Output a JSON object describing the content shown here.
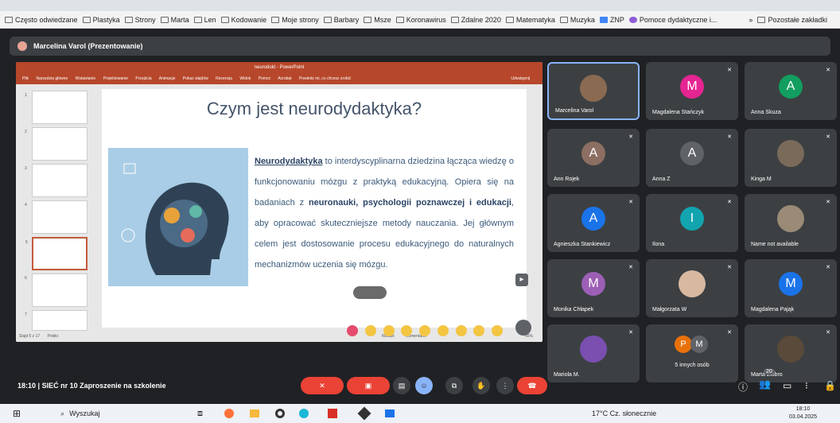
{
  "bookmarks": {
    "items": [
      "Często odwiedzane",
      "Plastyka",
      "Strony",
      "Marta",
      "Len",
      "Kodowanie",
      "Moje strony",
      "Barbary",
      "Msze",
      "Koronawirus",
      "Zdalne 2020",
      "Matematyka",
      "Muzyka",
      "ZNP",
      "Pomoce dydaktyczne i..."
    ],
    "more_label": "»",
    "other_label": "Pozostałe zakładki"
  },
  "meet": {
    "presenter_bar": "Marcelina Varol (Prezentowanie)",
    "time": "18:10",
    "separator": "|",
    "meeting_title": "SIEĆ nr 10 Zaproszenie na szkolenie",
    "participant_count": "20"
  },
  "ppt": {
    "window_title": "neurodukt - PowerPoint",
    "ribbon_tabs": [
      "Plik",
      "Narzędzia główne",
      "Wstawianie",
      "Projektowanie",
      "Przejścia",
      "Animacje",
      "Pokaz slajdów",
      "Recenzja",
      "Widok",
      "Pomoc",
      "Acrobat",
      "Powiedz mi, co chcesz zrobić"
    ],
    "share_label": "Udostępnij",
    "status_left": "Slajd 5 z 17",
    "status_lang": "Polski",
    "status_notes": "Notatki",
    "status_comments": "Komentarze",
    "zoom": "66%",
    "slide_numbers": [
      "1",
      "2",
      "3",
      "4",
      "5",
      "6",
      "7"
    ]
  },
  "slide": {
    "title": "Czym jest neurodydaktyka?",
    "p1_bold": "Neurodydaktyka",
    "p1_rest": " to interdyscyplinarna dziedzina łącząca wiedzę o funkcjonowaniu mózgu z praktyką edukacyjną. Opiera się na badaniach z ",
    "p1_bold2": "neuronauki, psychologii poznawczej i edukacji",
    "p1_end": ", aby opracować skuteczniejsze metody nauczania. Jej głównym celem jest dostosowanie procesu edukacyjnego do naturalnych mechanizmów uczenia się mózgu."
  },
  "participants": [
    {
      "name": "Marcelina Varol",
      "initial": "",
      "color": "#8a6a50"
    },
    {
      "name": "Magdalena Stańczyk",
      "initial": "M",
      "color": "#e52592"
    },
    {
      "name": "Anna Skuza",
      "initial": "A",
      "color": "#129e5e"
    },
    {
      "name": "Ann Rojek",
      "initial": "A",
      "color": "#8d6e63"
    },
    {
      "name": "Anna Z",
      "initial": "A",
      "color": "#5f6368"
    },
    {
      "name": "Kinga M",
      "initial": "",
      "color": "#7a6a5a"
    },
    {
      "name": "Agnieszka Stankiewicz",
      "initial": "A",
      "color": "#1a73e8"
    },
    {
      "name": "Ilona",
      "initial": "I",
      "color": "#12a4af"
    },
    {
      "name": "Name not available",
      "initial": "",
      "color": "#9a8a76"
    },
    {
      "name": "Monika Chłapek",
      "initial": "M",
      "color": "#9c5fb5"
    },
    {
      "name": "Małgorzata W",
      "initial": "",
      "color": "#d8b9a0"
    },
    {
      "name": "Magdalena Pająk",
      "initial": "M",
      "color": "#1a73e8"
    },
    {
      "name": "Mariola M.",
      "initial": "",
      "color": "#7a4fb0"
    },
    {
      "name": "5 innych osób",
      "initial": "",
      "color": "#e8710a"
    },
    {
      "name": "Marta Ziobro",
      "initial": "",
      "color": "#5a4a3a"
    }
  ],
  "others_initials": [
    "P",
    "M"
  ],
  "taskbar": {
    "search_placeholder": "Wyszukaj",
    "weather": "17°C  Cz. słonecznie",
    "time": "18:10",
    "date": "03.04.2025"
  },
  "colors": {
    "meet_bg": "#202124",
    "tile_bg": "#3c4043",
    "end_call": "#ea4335",
    "ppt_accent": "#b7472a"
  }
}
